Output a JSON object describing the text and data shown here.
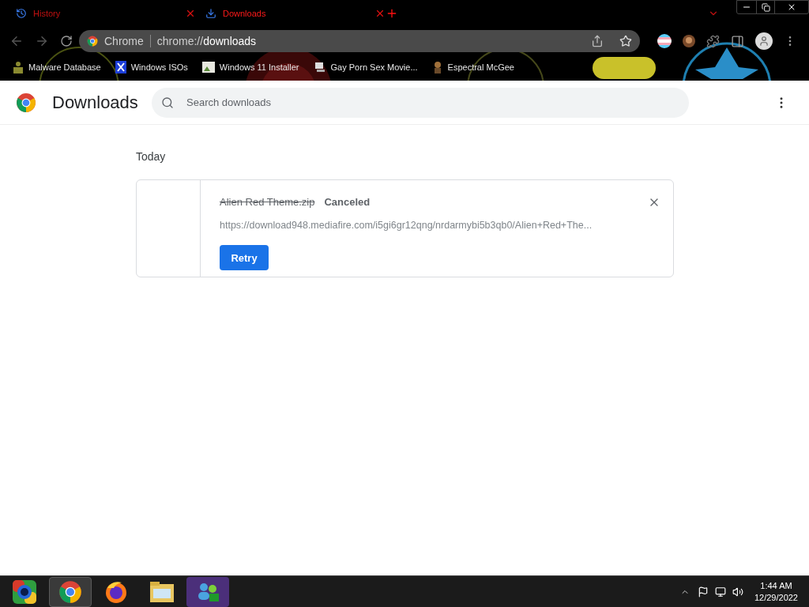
{
  "tabs": [
    {
      "label": "History",
      "selected": false
    },
    {
      "label": "Downloads",
      "selected": true
    }
  ],
  "omnibox": {
    "site": "Chrome",
    "url_prefix": "chrome://",
    "url_path": "downloads"
  },
  "bookmarks": [
    {
      "label": "Malware Database"
    },
    {
      "label": "Windows ISOs"
    },
    {
      "label": "Windows 11 Installer"
    },
    {
      "label": "Gay Porn Sex Movie..."
    },
    {
      "label": "Espectral McGee"
    }
  ],
  "header": {
    "title": "Downloads",
    "search_placeholder": "Search downloads"
  },
  "section": "Today",
  "downloads": [
    {
      "file": "Alien Red Theme.zip",
      "status": "Canceled",
      "canceled": true,
      "url": "https://download948.mediafire.com/i5gi6gr12qng/nrdarmybi5b3qb0/Alien+Red+The...",
      "action": "Retry"
    }
  ],
  "taskbar": {
    "apps": [
      {
        "kind": "start",
        "selected": false
      },
      {
        "kind": "chrome",
        "selected": true
      },
      {
        "kind": "firefox",
        "selected": false
      },
      {
        "kind": "explorer",
        "selected": false
      },
      {
        "kind": "messenger",
        "selected": false
      }
    ],
    "time": "1:44 AM",
    "date": "12/29/2022"
  }
}
